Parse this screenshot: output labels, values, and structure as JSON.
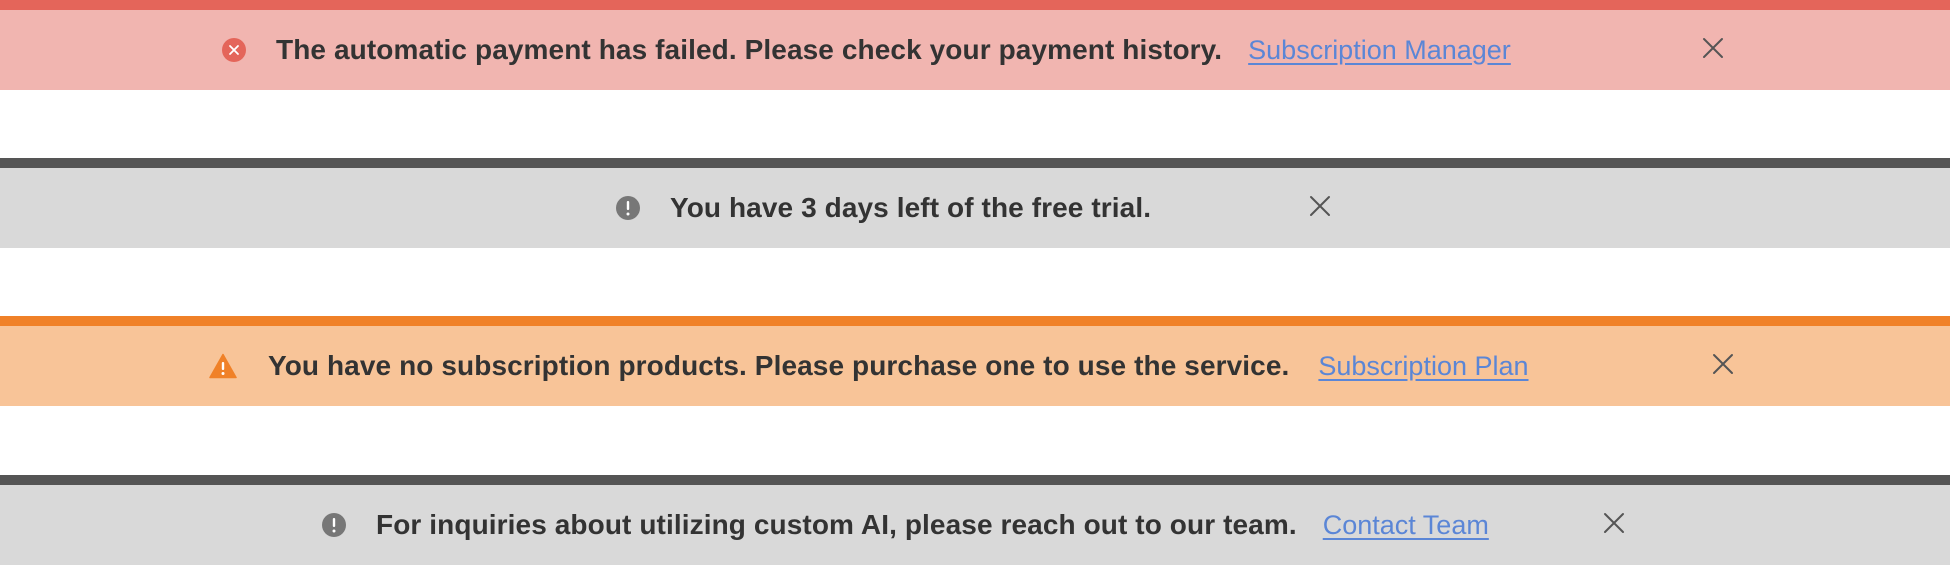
{
  "colors": {
    "error_bar": "#e4655a",
    "error_bg": "#f1b5b0",
    "error_icon": "#e4655a",
    "info_bar": "#555555",
    "info_bg": "#d9d9d9",
    "info_icon": "#777777",
    "warning_bar": "#f08128",
    "warning_bg": "#f8c498",
    "warning_icon": "#f08128",
    "text": "#333333",
    "link": "#5b86d6",
    "close": "#555555"
  },
  "banners": [
    {
      "type": "error",
      "icon": "error-circle-icon",
      "message": "The automatic payment has failed. Please check your payment history.",
      "link": "Subscription Manager",
      "close_icon": "close-icon"
    },
    {
      "type": "info",
      "icon": "info-circle-icon",
      "message": "You have 3 days left of the free trial.",
      "close_icon": "close-icon"
    },
    {
      "type": "warning",
      "icon": "warning-triangle-icon",
      "message": "You have no subscription products. Please purchase one to use the service.",
      "link": "Subscription Plan",
      "close_icon": "close-icon"
    },
    {
      "type": "info",
      "icon": "info-circle-icon",
      "message": "For inquiries about utilizing custom AI, please reach out to our team.",
      "link": "Contact Team",
      "close_icon": "close-icon"
    }
  ]
}
